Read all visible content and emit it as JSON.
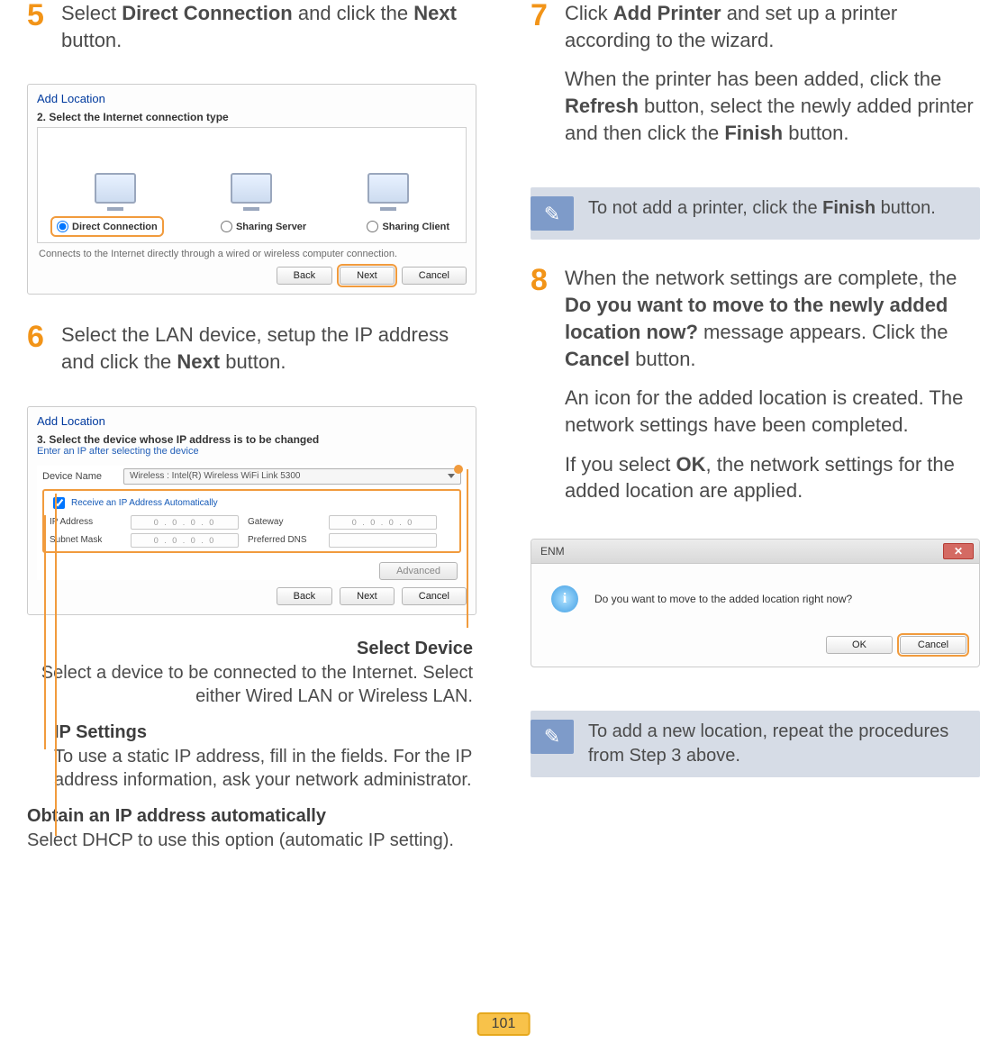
{
  "page_number": "101",
  "steps": {
    "5": {
      "num": "5",
      "html": "Select <b>Direct Connection</b> and click the <b>Next</b> button."
    },
    "6": {
      "num": "6",
      "html": "Select the LAN device, setup the IP address and click the <b>Next</b> button."
    },
    "7": {
      "num": "7",
      "p1": "Click <b>Add Printer</b> and set up a printer according to the wizard.",
      "p2": "When the printer has been added, click the <b>Refresh</b> button, select the newly added printer and then click the <b>Finish</b> button."
    },
    "8": {
      "num": "8",
      "p1": "When the network settings are complete, the <b>Do you want to move to the newly added location now?</b> message appears. Click the <b>Cancel</b> button.",
      "p2": "An icon for the added location is created. The network settings have been completed.",
      "p3": "If you select <b>OK</b>, the network settings for the added location are applied."
    }
  },
  "notes": {
    "finish": "To not add a printer, click the <b>Finish</b> button.",
    "repeat": "To add a new location, repeat the procedures from Step 3 above."
  },
  "mock1": {
    "window_title": "Add Location",
    "step_title": "2. Select the Internet connection type",
    "radio_direct": "Direct Connection",
    "radio_server": "Sharing Server",
    "radio_client": "Sharing Client",
    "desc": "Connects to the Internet directly through a wired or wireless computer connection.",
    "btn_back": "Back",
    "btn_next": "Next",
    "btn_cancel": "Cancel"
  },
  "mock2": {
    "window_title": "Add Location",
    "step_title": "3. Select the device whose IP address is to be changed",
    "subtitle": "Enter an IP after selecting the device",
    "device_label": "Device Name",
    "device_value": "Wireless : Intel(R) Wireless WiFi Link 5300",
    "auto_label": "Receive an IP Address Automatically",
    "ip_label": "IP Address",
    "subnet_label": "Subnet Mask",
    "gateway_label": "Gateway",
    "dns_label": "Preferred DNS",
    "ip_placeholder": "0 . 0 . 0 . 0",
    "btn_advanced": "Advanced",
    "btn_back": "Back",
    "btn_next": "Next",
    "btn_cancel": "Cancel"
  },
  "callouts": {
    "select_device": {
      "title": "Select Device",
      "text": "Select a device to be connected to the Internet. Select either Wired LAN or Wireless LAN."
    },
    "ip_settings": {
      "title": "IP Settings",
      "text": "To use a static IP address, fill in the fields. For the IP address information, ask your network administrator."
    },
    "auto_ip": {
      "title": "Obtain an IP address automatically",
      "text": "Select DHCP to use this option (automatic IP setting)."
    }
  },
  "mock3": {
    "title": "ENM",
    "message": "Do you want to move to the added location right now?",
    "btn_ok": "OK",
    "btn_cancel": "Cancel"
  }
}
